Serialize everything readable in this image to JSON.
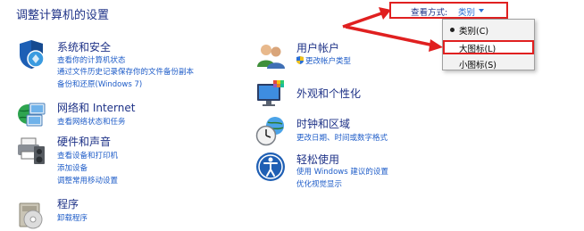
{
  "page": {
    "title": "调整计算机的设置"
  },
  "view_by": {
    "label": "查看方式:",
    "value": "类别"
  },
  "view_menu": {
    "items": [
      {
        "label": "类别(C)",
        "selected": true
      },
      {
        "label": "大图标(L)",
        "selected": false,
        "highlighted": true
      },
      {
        "label": "小图标(S)",
        "selected": false
      }
    ]
  },
  "categories": [
    {
      "title": "系统和安全",
      "icon": "shield-flag-icon",
      "links": [
        "查看你的计算机状态",
        "通过文件历史记录保存你的文件备份副本",
        "备份和还原(Windows 7)"
      ]
    },
    {
      "title": "网络和 Internet",
      "icon": "network-globe-icon",
      "links": [
        "查看网络状态和任务"
      ]
    },
    {
      "title": "硬件和声音",
      "icon": "printer-speaker-icon",
      "links": [
        "查看设备和打印机",
        "添加设备",
        "调整常用移动设置"
      ]
    },
    {
      "title": "程序",
      "icon": "program-disc-icon",
      "links": [
        "卸载程序"
      ]
    },
    {
      "title": "用户帐户",
      "icon": "users-icon",
      "links": [
        "更改帐户类型"
      ]
    },
    {
      "title": "外观和个性化",
      "icon": "monitor-palette-icon",
      "links": []
    },
    {
      "title": "时钟和区域",
      "icon": "clock-globe-icon",
      "links": [
        "更改日期、时间或数字格式"
      ]
    },
    {
      "title": "轻松使用",
      "icon": "accessibility-icon",
      "links": [
        "使用 Windows 建议的设置",
        "优化视觉显示"
      ]
    }
  ],
  "colors": {
    "title_blue": "#1e3287",
    "link_blue": "#1e5cc8",
    "annotation_red": "#e02020"
  }
}
